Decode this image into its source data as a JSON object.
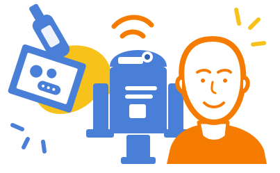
{
  "illustration": {
    "subjects": [
      "bottle-icon",
      "device-with-speech-bubble-icon",
      "signal-waves-icon",
      "robot-icon",
      "person-icon",
      "sparkle-lines-icon"
    ],
    "colors": {
      "blue": "#4a7fd8",
      "dark_blue": "#2f5fae",
      "yellow": "#f7c21c",
      "orange": "#f57c00",
      "skin": "#ffffff",
      "outline": "#f57c00"
    }
  }
}
